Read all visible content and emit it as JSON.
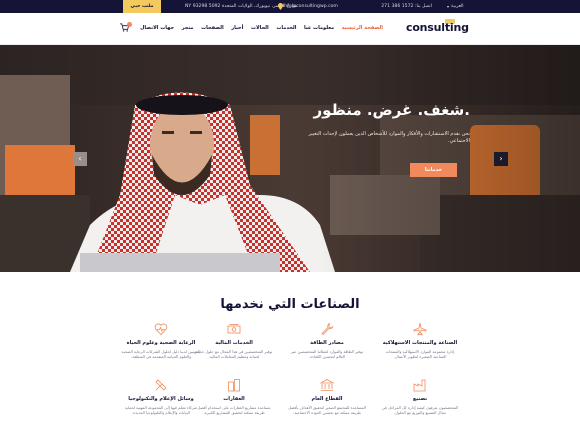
{
  "topbar": {
    "language": "العربية",
    "phone": "اتصل بنا: 1572 386 271",
    "email": "info@consultingwp.com",
    "address": "NY 93298 5092 شارع الجسر، نيويورك، الولايات المتحدة",
    "cta_label": "ملتب حبي"
  },
  "nav": {
    "logo_text": "consulting",
    "logo_badge": "WP",
    "items": [
      {
        "label": "الصفحة الرئيسية",
        "active": true
      },
      {
        "label": "معلومات عنا"
      },
      {
        "label": "الخدمات"
      },
      {
        "label": "الحالات"
      },
      {
        "label": "أخبار"
      },
      {
        "label": "الصفحات"
      },
      {
        "label": "متجر"
      },
      {
        "label": "جهات الاتصال"
      }
    ],
    "cart_count": "0"
  },
  "hero": {
    "title": "شغف. غرض. منظور.",
    "subtitle": "نحن نقدم الاستشارات والأفكار والموارد للأشخاص الذين يعملون لإحداث التغيير الاجتماعي.",
    "button_label": "خدماتنا"
  },
  "industries": {
    "title": "الصناعات التي نخدمها",
    "cards": [
      {
        "title": "الصناعة والمنتجات الاستهلاكية",
        "desc": "إدارة مجموعة الموارد الاستهلاكية والمنتجات الصناعية الصغيرة لتطوير الأعمال.",
        "icon": "plane-icon"
      },
      {
        "title": "مصادر الطاقة",
        "desc": "توفير الطاقة والموارد لعملائنا المتخصصين عبر العالم لتحسين الكفاءة.",
        "icon": "wrench-icon"
      },
      {
        "title": "الخدمات المالية",
        "desc": "توفير المتخصصين في هذا المجال مع حلول حديثة لحماية وتنظيم المعاملات المالية.",
        "icon": "money-icon"
      },
      {
        "title": "الرعاية الصحية وعلوم الحياة",
        "desc": "المهنيين لدينا دليل لحلول الشركات الرعاية الصحية والعلوم الحياتية المتقدمة في المنطقة.",
        "icon": "heart-pulse-icon"
      },
      {
        "title": "تصنيع",
        "desc": "المتخصصون يعرفون كيفية إدارة كل المراحل في مجال التصنيع والتوزيع مع الحلول.",
        "icon": "factory-icon"
      },
      {
        "title": "القطاع العام",
        "desc": "المساعدة للمجتمع الصغير لتحقيق الأهداف بأفضل طريقة ممكنة مع تحسين الجودة الاجتماعية.",
        "icon": "building-icon"
      },
      {
        "title": "العقارات",
        "desc": "مساعدة مشاريع العقارات على استخدام أفضل طريقة ممكنة لتحقيق المشاريع الكبيرة.",
        "icon": "buildings-icon"
      },
      {
        "title": "وسائل الإعلام والتكنولوجيا",
        "desc": "شركاء نتعلم فيها إلى المجموعة المهنية لحماية البيانات والإعلام والتكنولوجيا الجديدة.",
        "icon": "tools-icon"
      }
    ]
  },
  "colors": {
    "accent": "#f08a5d",
    "navy": "#141437",
    "gold": "#f4c95d"
  }
}
